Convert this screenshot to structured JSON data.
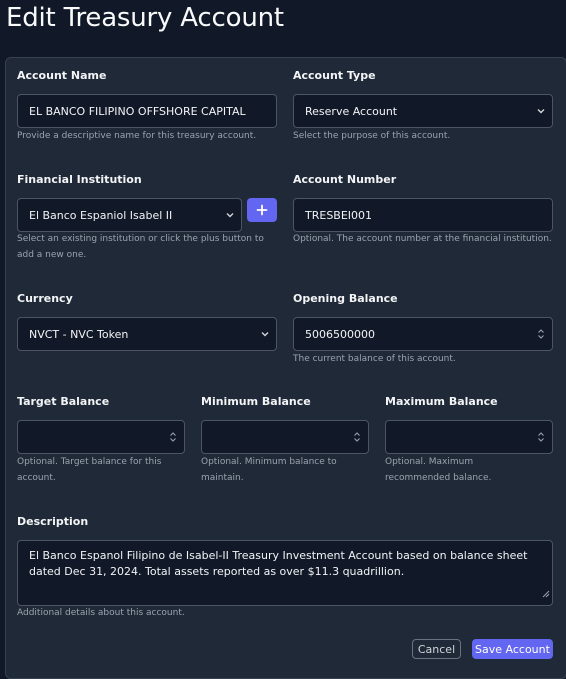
{
  "page": {
    "title": "Edit Treasury Account"
  },
  "form": {
    "account_name": {
      "label": "Account Name",
      "value": "EL BANCO FILIPINO OFFSHORE CAPITAL",
      "help": "Provide a descriptive name for this treasury account."
    },
    "account_type": {
      "label": "Account Type",
      "value": "Reserve Account",
      "help": "Select the purpose of this account."
    },
    "financial_institution": {
      "label": "Financial Institution",
      "value": "El Banco Espaniol Isabel II",
      "help": "Select an existing institution or click the plus button to add a new one.",
      "add_button_icon": "plus-icon"
    },
    "account_number": {
      "label": "Account Number",
      "value": "TRESBEI001",
      "help": "Optional. The account number at the financial institution."
    },
    "currency": {
      "label": "Currency",
      "value": "NVCT - NVC Token",
      "help": ""
    },
    "opening_balance": {
      "label": "Opening Balance",
      "value": "5006500000",
      "help": "The current balance of this account."
    },
    "target_balance": {
      "label": "Target Balance",
      "value": "",
      "help": "Optional. Target balance for this account."
    },
    "minimum_balance": {
      "label": "Minimum Balance",
      "value": "",
      "help": "Optional. Minimum balance to maintain."
    },
    "maximum_balance": {
      "label": "Maximum Balance",
      "value": "",
      "help": "Optional. Maximum recommended balance."
    },
    "description": {
      "label": "Description",
      "value": "El Banco Espanol Filipino de Isabel-II Treasury Investment Account based on balance sheet dated Dec 31, 2024. Total assets reported as over $11.3 quadrillion.",
      "help": "Additional details about this account."
    }
  },
  "actions": {
    "cancel_label": "Cancel",
    "save_label": "Save Account"
  },
  "colors": {
    "accent": "#6366f1",
    "background": "#111827",
    "card": "#1f2937",
    "border": "#4b5563"
  }
}
